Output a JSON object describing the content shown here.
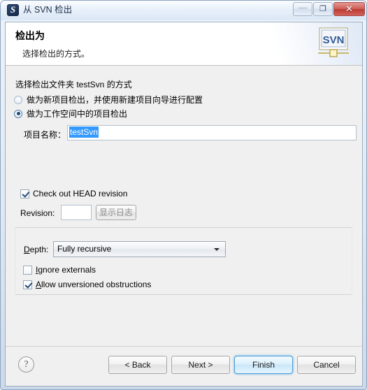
{
  "window": {
    "title": "从 SVN 检出",
    "icon": "svn-app-icon",
    "controls": {
      "minimize": "—",
      "restore": "❐",
      "close": "✕"
    }
  },
  "header": {
    "title": "检出为",
    "subtitle": "选择检出的方式。",
    "logo_text": "SVN"
  },
  "body": {
    "mode_prompt": "选择检出文件夹 testSvn 的方式",
    "mode_options": [
      {
        "label": "做为新项目检出，并使用新建项目向导进行配置",
        "checked": false
      },
      {
        "label": "做为工作空间中的项目检出",
        "checked": true
      }
    ],
    "project_name": {
      "label": "项目名称：",
      "value": "testSvn",
      "selected": true
    },
    "head_revision": {
      "label": "Check out HEAD revision",
      "checked": true
    },
    "revision": {
      "label": "Revision:",
      "value": "",
      "show_log_button": "显示日志",
      "show_log_enabled": false
    },
    "depth": {
      "label": "Depth:",
      "mnemonic": "D",
      "value": "Fully recursive"
    },
    "ignore_externals": {
      "label": "Ignore externals",
      "mnemonic": "I",
      "checked": false
    },
    "allow_unversioned": {
      "label": "Allow unversioned obstructions",
      "mnemonic": "A",
      "checked": true
    }
  },
  "footer": {
    "help": "?",
    "buttons": [
      {
        "name": "back",
        "label": "< Back",
        "default": false
      },
      {
        "name": "next",
        "label": "Next >",
        "default": false
      },
      {
        "name": "finish",
        "label": "Finish",
        "default": true
      },
      {
        "name": "cancel",
        "label": "Cancel",
        "default": false
      }
    ]
  },
  "colors": {
    "selection": "#3399ff",
    "default_button_border": "#4c9ed9",
    "client_bg": "#f0f0f0",
    "titlebar_text": "#1b2f4a"
  }
}
